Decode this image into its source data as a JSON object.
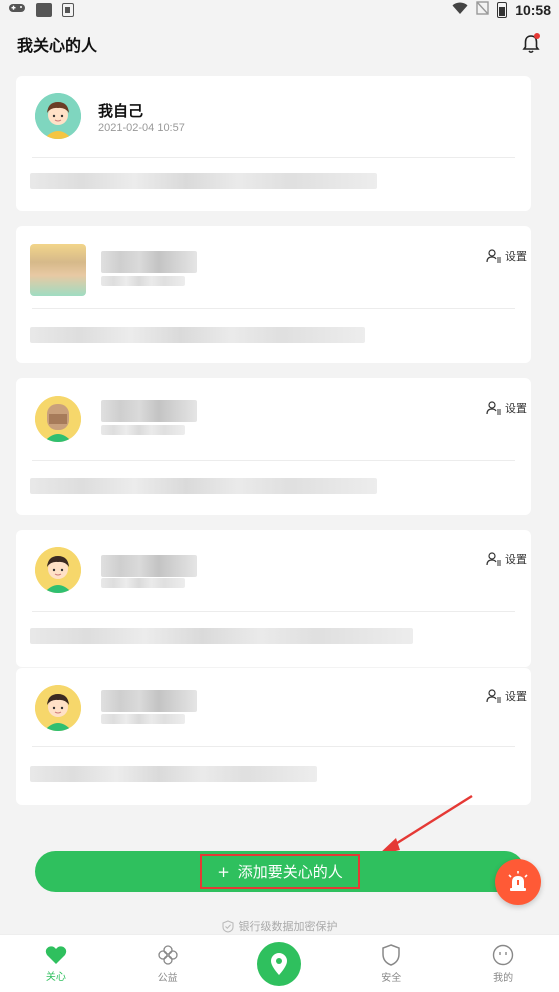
{
  "status_bar": {
    "time": "10:58"
  },
  "header": {
    "title": "我关心的人"
  },
  "cards": [
    {
      "name": "我自己",
      "date": "2021-02-04 10:57",
      "setting_label": ""
    },
    {
      "name": "",
      "date": "",
      "setting_label": "设置"
    },
    {
      "name": "",
      "date": "",
      "setting_label": "设置"
    },
    {
      "name": "",
      "date": "",
      "setting_label": "设置"
    },
    {
      "name": "",
      "date": "",
      "setting_label": "设置"
    }
  ],
  "add_button": {
    "plus": "+",
    "label": "添加要关心的人"
  },
  "security_note": "银行级数据加密保护",
  "tabs": [
    {
      "label": "关心",
      "icon": "heart-icon",
      "active": true
    },
    {
      "label": "公益",
      "icon": "clover-icon",
      "active": false
    },
    {
      "label": "",
      "icon": "location-pin-icon",
      "active": false
    },
    {
      "label": "安全",
      "icon": "shield-icon",
      "active": false
    },
    {
      "label": "我的",
      "icon": "face-icon",
      "active": false
    }
  ],
  "colors": {
    "accent": "#2fc05e",
    "alert": "#e53935",
    "sos": "#ff5a36"
  }
}
